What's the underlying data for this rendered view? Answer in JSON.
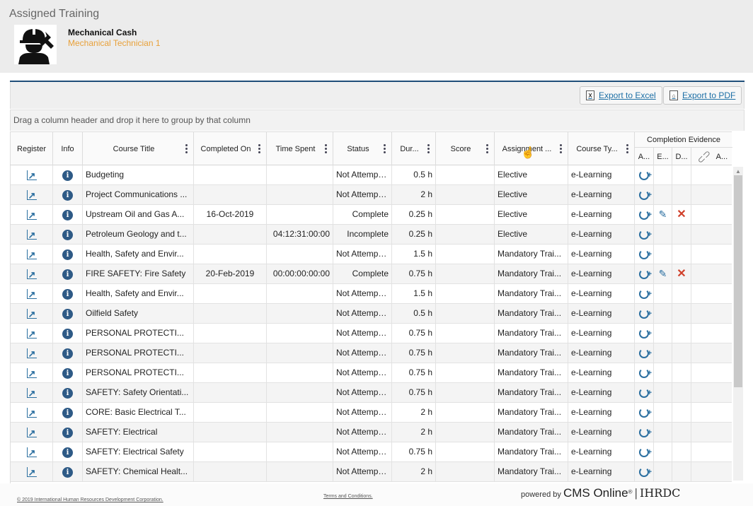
{
  "page": {
    "title": "Assigned Training"
  },
  "user": {
    "name": "Mechanical Cash",
    "role": "Mechanical Technician 1"
  },
  "toolbar": {
    "export_excel": "Export to Excel",
    "export_pdf": "Export to PDF"
  },
  "group_hint": "Drag a column header and drop it here to group by that column",
  "columns": {
    "register": "Register",
    "info": "Info",
    "course_title": "Course Title",
    "completed_on": "Completed On",
    "time_spent": "Time Spent",
    "status": "Status",
    "duration": "Dur...",
    "score": "Score",
    "assignment": "Assignment ...",
    "course_type": "Course Ty...",
    "completion_evidence": "Completion Evidence",
    "ce_a": "A...",
    "ce_e": "E...",
    "ce_d": "D...",
    "ce_att": "A..."
  },
  "rows": [
    {
      "title": "Budgeting",
      "completed": "",
      "time": "",
      "status": "Not Attempted",
      "dur": "0.5 h",
      "score": "",
      "assign": "Elective",
      "type": "e-Learning",
      "evidence": false
    },
    {
      "title": "Project Communications ...",
      "completed": "",
      "time": "",
      "status": "Not Attempted",
      "dur": "2 h",
      "score": "",
      "assign": "Elective",
      "type": "e-Learning",
      "evidence": false
    },
    {
      "title": "Upstream Oil and Gas A...",
      "completed": "16-Oct-2019",
      "time": "",
      "status": "Complete",
      "dur": "0.25 h",
      "score": "",
      "assign": "Elective",
      "type": "e-Learning",
      "evidence": true
    },
    {
      "title": "Petroleum Geology and t...",
      "completed": "",
      "time": "04:12:31:00:00",
      "status": "Incomplete",
      "dur": "0.25 h",
      "score": "",
      "assign": "Elective",
      "type": "e-Learning",
      "evidence": false
    },
    {
      "title": "Health, Safety and Envir...",
      "completed": "",
      "time": "",
      "status": "Not Attempted",
      "dur": "1.5 h",
      "score": "",
      "assign": "Mandatory Trai...",
      "type": "e-Learning",
      "evidence": false
    },
    {
      "title": "FIRE SAFETY: Fire Safety",
      "completed": "20-Feb-2019",
      "time": "00:00:00:00:00",
      "status": "Complete",
      "dur": "0.75 h",
      "score": "",
      "assign": "Mandatory Trai...",
      "type": "e-Learning",
      "evidence": true
    },
    {
      "title": "Health, Safety and Envir...",
      "completed": "",
      "time": "",
      "status": "Not Attempted",
      "dur": "1.5 h",
      "score": "",
      "assign": "Mandatory Trai...",
      "type": "e-Learning",
      "evidence": false
    },
    {
      "title": "Oilfield Safety",
      "completed": "",
      "time": "",
      "status": "Not Attempted",
      "dur": "0.5 h",
      "score": "",
      "assign": "Mandatory Trai...",
      "type": "e-Learning",
      "evidence": false
    },
    {
      "title": "PERSONAL PROTECTI...",
      "completed": "",
      "time": "",
      "status": "Not Attempted",
      "dur": "0.75 h",
      "score": "",
      "assign": "Mandatory Trai...",
      "type": "e-Learning",
      "evidence": false
    },
    {
      "title": "PERSONAL PROTECTI...",
      "completed": "",
      "time": "",
      "status": "Not Attempted",
      "dur": "0.75 h",
      "score": "",
      "assign": "Mandatory Trai...",
      "type": "e-Learning",
      "evidence": false
    },
    {
      "title": "PERSONAL PROTECTI...",
      "completed": "",
      "time": "",
      "status": "Not Attempted",
      "dur": "0.75 h",
      "score": "",
      "assign": "Mandatory Trai...",
      "type": "e-Learning",
      "evidence": false
    },
    {
      "title": "SAFETY: Safety Orientati...",
      "completed": "",
      "time": "",
      "status": "Not Attempted",
      "dur": "0.75 h",
      "score": "",
      "assign": "Mandatory Trai...",
      "type": "e-Learning",
      "evidence": false
    },
    {
      "title": "CORE: Basic Electrical T...",
      "completed": "",
      "time": "",
      "status": "Not Attempted",
      "dur": "2 h",
      "score": "",
      "assign": "Mandatory Trai...",
      "type": "e-Learning",
      "evidence": false
    },
    {
      "title": "SAFETY: Electrical",
      "completed": "",
      "time": "",
      "status": "Not Attempted",
      "dur": "2 h",
      "score": "",
      "assign": "Mandatory Trai...",
      "type": "e-Learning",
      "evidence": false
    },
    {
      "title": "SAFETY: Electrical Safety",
      "completed": "",
      "time": "",
      "status": "Not Attempted",
      "dur": "0.75 h",
      "score": "",
      "assign": "Mandatory Trai...",
      "type": "e-Learning",
      "evidence": false
    },
    {
      "title": "SAFETY: Chemical Healt...",
      "completed": "",
      "time": "",
      "status": "Not Attempted",
      "dur": "2 h",
      "score": "",
      "assign": "Mandatory Trai...",
      "type": "e-Learning",
      "evidence": false
    }
  ],
  "footer": {
    "copyright": "© 2019 International Human Resources Development Corporation.",
    "terms": "Terms and Conditions.",
    "powered_by": "powered by",
    "brand": "CMS Online",
    "brand_sup": "®",
    "brand_sep": "|",
    "brand2": "IHRDC"
  },
  "colors": {
    "accent": "#1f4e79",
    "role": "#e8a13a",
    "link": "#1d6fa5",
    "delete": "#d0402a"
  }
}
